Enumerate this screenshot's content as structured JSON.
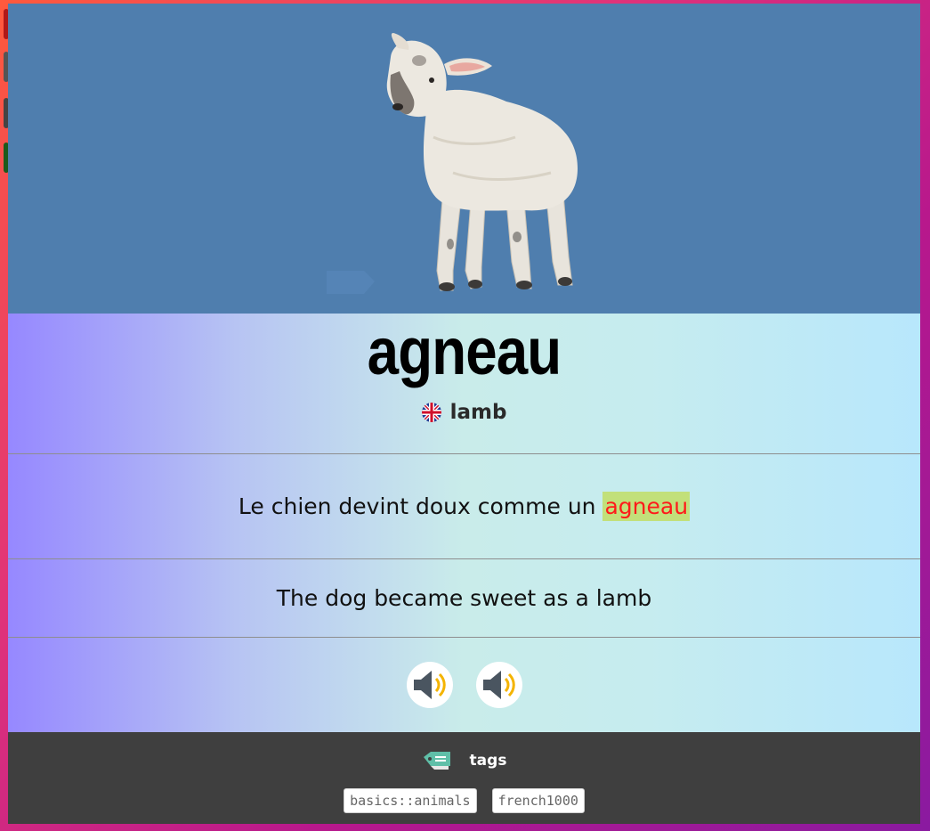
{
  "card": {
    "image_alt": "lamb",
    "word": "agneau",
    "translation": "lamb",
    "sentence_fr_before": "Le chien devint doux comme un ",
    "sentence_fr_highlight": "agneau",
    "sentence_en": "The dog became sweet as a lamb"
  },
  "audio": [
    {
      "icon": "speaker-icon"
    },
    {
      "icon": "speaker-icon"
    }
  ],
  "footer": {
    "tags_label": "tags",
    "tags": [
      "basics::animals",
      "french1000"
    ]
  },
  "colors": {
    "image_background": "#4f7eae",
    "highlight_background": "#c2e07a",
    "highlight_text": "#ff1a1a",
    "footer_background": "#3f3f3f"
  }
}
